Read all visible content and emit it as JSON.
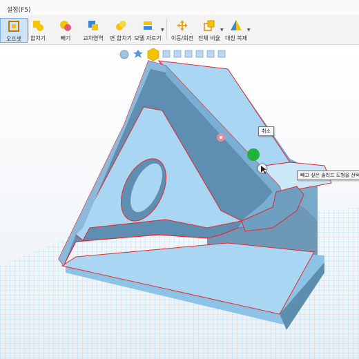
{
  "menu": {
    "title": "설정(F5)"
  },
  "toolbar": {
    "tools": [
      {
        "label": "오프셋",
        "icon": "offset-icon"
      },
      {
        "label": "합치기",
        "icon": "union-icon"
      },
      {
        "label": "빼기",
        "icon": "subtract-icon"
      },
      {
        "label": "교차영역",
        "icon": "intersect-icon"
      },
      {
        "label": "면 합치기",
        "icon": "merge-faces-icon"
      },
      {
        "label": "모델 자르기",
        "icon": "cut-model-icon"
      },
      {
        "label": "이동/회전",
        "icon": "move-rotate-icon"
      },
      {
        "label": "전체 비율",
        "icon": "scale-icon"
      },
      {
        "label": "대칭 복제",
        "icon": "mirror-copy-icon"
      }
    ]
  },
  "viewport": {
    "cancel_tooltip": "취소",
    "hint_tooltip": "빼고 싶은 솔리드 도형을 선택하"
  },
  "colors": {
    "accent": "#cfe4f7",
    "model_face": "#a9d6f2",
    "model_edge": "#e8262c",
    "grid": "#7fd0ee"
  }
}
